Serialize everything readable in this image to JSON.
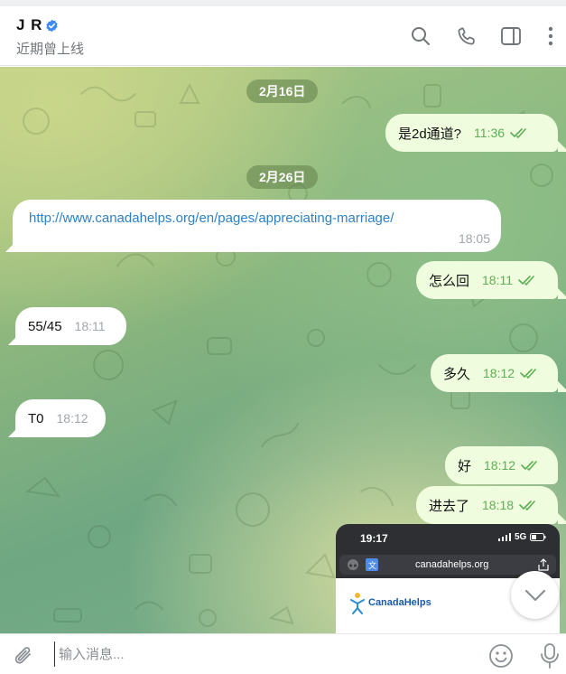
{
  "header": {
    "title": "J R",
    "subtitle": "近期曾上线",
    "icons": [
      "verified-badge-icon",
      "search-icon",
      "phone-icon",
      "sidebar-toggle-icon",
      "more-vertical-icon"
    ]
  },
  "messages": {
    "date1": "2月16日",
    "m1": {
      "text": "是2d通道?",
      "time": "11:36"
    },
    "date2": "2月26日",
    "m2": {
      "text": "http://www.canadahelps.org/en/pages/appreciating-marriage/",
      "time": "18:05"
    },
    "m3": {
      "text": "怎么回",
      "time": "18:11"
    },
    "m4": {
      "text": "55/45",
      "time": "18:11"
    },
    "m5": {
      "text": "多久",
      "time": "18:12"
    },
    "m6": {
      "text": "T0",
      "time": "18:12"
    },
    "m7": {
      "text": "好",
      "time": "18:12"
    },
    "m8": {
      "text": "进去了",
      "time": "18:18"
    }
  },
  "photo": {
    "status_time": "19:17",
    "network": "5G",
    "url": "canadahelps.org",
    "logo_text": "CanadaHelps"
  },
  "composer": {
    "placeholder": "输入消息...",
    "icons": [
      "attach-icon",
      "emoji-icon",
      "microphone-icon"
    ]
  },
  "colors": {
    "outgoing_bubble": "#effdde",
    "incoming_bubble": "#ffffff",
    "time_outgoing": "#5fad56",
    "link": "#2f80c5",
    "badge": "#3d8af7"
  }
}
